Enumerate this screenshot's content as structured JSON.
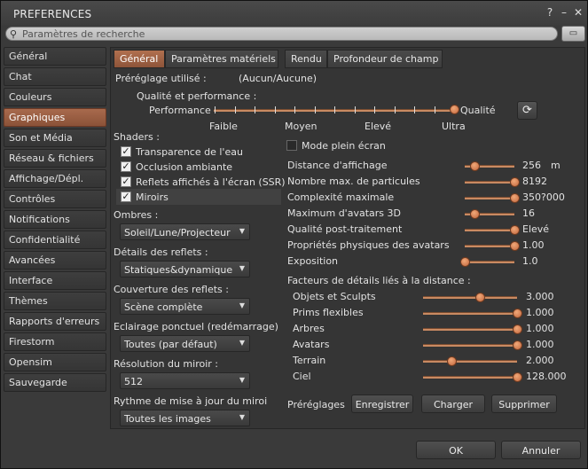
{
  "window": {
    "title": "PREFERENCES",
    "help": "?",
    "minimize": "–",
    "close": "✕"
  },
  "search": {
    "placeholder": "Paramètres de recherche",
    "button": "▭"
  },
  "sidebar": {
    "items": [
      {
        "label": "Général"
      },
      {
        "label": "Chat"
      },
      {
        "label": "Couleurs"
      },
      {
        "label": "Graphiques",
        "active": true
      },
      {
        "label": "Son et Média"
      },
      {
        "label": "Réseau & fichiers"
      },
      {
        "label": "Affichage/Dépl."
      },
      {
        "label": "Contrôles"
      },
      {
        "label": "Notifications"
      },
      {
        "label": "Confidentialité"
      },
      {
        "label": "Avancées"
      },
      {
        "label": "Interface"
      },
      {
        "label": "Thèmes"
      },
      {
        "label": "Rapports d'erreurs"
      },
      {
        "label": "Firestorm"
      },
      {
        "label": "Opensim"
      },
      {
        "label": "Sauvegarde"
      }
    ]
  },
  "tabs": [
    "Général",
    "Paramètres matériels",
    "Rendu",
    "Profondeur de champ"
  ],
  "preset": {
    "label": "Préréglage utilisé :",
    "value": "(Aucun/Aucune)"
  },
  "quality": {
    "title": "Qualité et performance :",
    "left": "Performance",
    "right": "Qualité",
    "ticks": [
      "Faible",
      "Moyen",
      "Elevé",
      "Ultra"
    ],
    "level": 1.0
  },
  "shaders": {
    "title": "Shaders :",
    "items": [
      {
        "label": "Transparence de l'eau",
        "checked": true
      },
      {
        "label": "Occlusion ambiante",
        "checked": true
      },
      {
        "label": "Reflets affichés à l'écran (SSR)",
        "checked": true
      },
      {
        "label": "Miroirs",
        "checked": true
      }
    ]
  },
  "combos": [
    {
      "label": "Ombres :",
      "value": "Soleil/Lune/Projecteur"
    },
    {
      "label": "Détails des reflets :",
      "value": "Statiques&dynamique"
    },
    {
      "label": "Couverture des reflets :",
      "value": "Scène complète"
    },
    {
      "label": "Eclairage ponctuel (redémarrage)",
      "value": "Toutes (par défaut)"
    },
    {
      "label": "Résolution du miroir :",
      "value": "512"
    },
    {
      "label": "Rythme de mise à jour du miroi",
      "value": "Toutes les images"
    }
  ],
  "fullscreen": {
    "label": "Mode plein écran",
    "checked": false
  },
  "right_sliders": [
    {
      "label": "Distance d'affichage",
      "value": "256",
      "unit": "m",
      "level": 0.2
    },
    {
      "label": "Nombre max. de particules",
      "value": "8192",
      "level": 1.0
    },
    {
      "label": "Complexité maximale",
      "value": "350?000",
      "level": 1.0
    },
    {
      "label": "Maximum d'avatars 3D",
      "value": "16",
      "level": 0.2
    },
    {
      "label": "Qualité post-traitement",
      "value": "Elevé",
      "level": 1.0
    },
    {
      "label": "Propriétés physiques des avatars",
      "value": "1.00",
      "level": 1.0
    },
    {
      "label": "Exposition",
      "value": "1.0",
      "level": 0.0
    }
  ],
  "lod": {
    "title": "Facteurs de détails liés à la distance :",
    "items": [
      {
        "label": "Objets et Sculpts",
        "value": "3.000",
        "level": 0.6
      },
      {
        "label": "Prims flexibles",
        "value": "1.000",
        "level": 1.0
      },
      {
        "label": "Arbres",
        "value": "1.000",
        "level": 1.0
      },
      {
        "label": "Avatars",
        "value": "1.000",
        "level": 1.0
      },
      {
        "label": "Terrain",
        "value": "2.000",
        "level": 0.3
      },
      {
        "label": "Ciel",
        "value": "128.000",
        "level": 1.0
      }
    ]
  },
  "presets_row": {
    "label": "Préréglages",
    "save": "Enregistrer",
    "load": "Charger",
    "delete": "Supprimer"
  },
  "footer": {
    "ok": "OK",
    "cancel": "Annuler"
  }
}
